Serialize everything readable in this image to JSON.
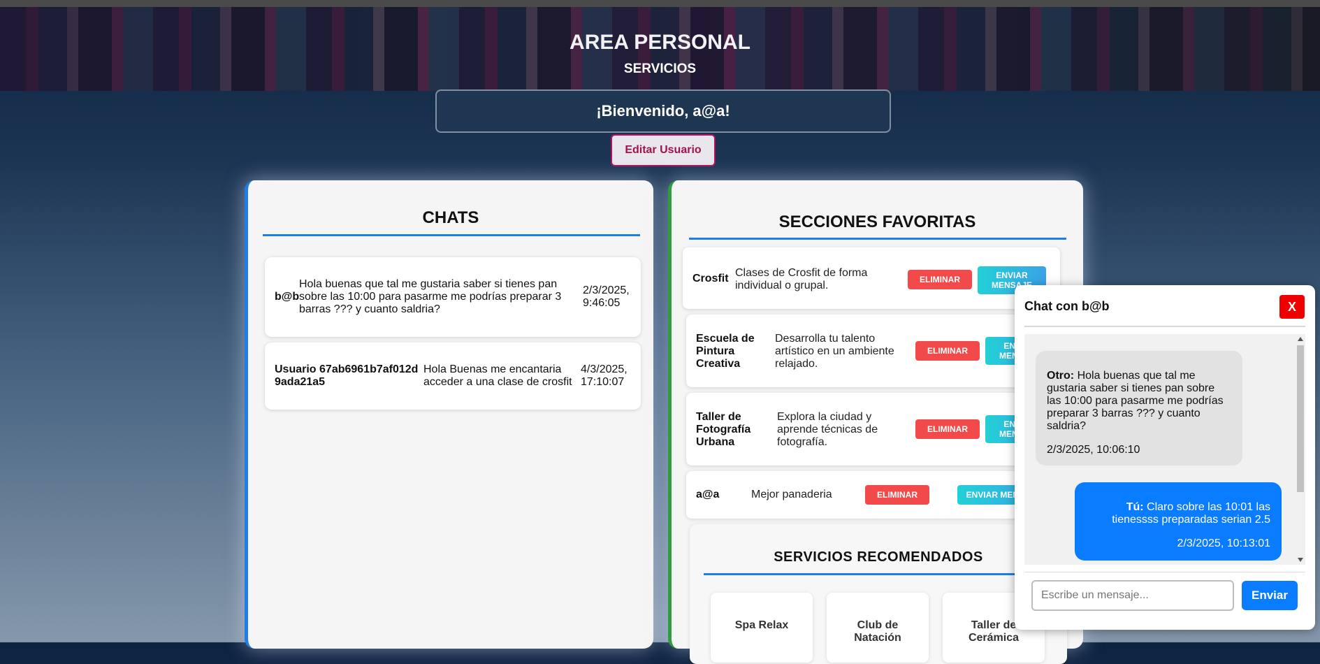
{
  "header": {
    "title": "AREA PERSONAL",
    "subtitle": "SERVICIOS"
  },
  "welcome": {
    "text": "¡Bienvenido, a@a!",
    "edit_button": "Editar Usuario"
  },
  "chats": {
    "title": "CHATS",
    "items": [
      {
        "user": "b@b",
        "message": "Hola buenas que tal me gustaria saber si tienes pan sobre las 10:00 para pasarme me podrías preparar 3 barras ??? y cuanto saldria?",
        "date": "2/3/2025,",
        "time": "9:46:05"
      },
      {
        "user": "Usuario 67ab6961b7af012d9ada21a5",
        "message": "Hola Buenas me encantaria acceder a una clase de crosfit",
        "date": "4/3/2025,",
        "time": "17:10:07"
      }
    ]
  },
  "favorites": {
    "title": "SECCIONES FAVORITAS",
    "delete_label": "ELIMINAR",
    "message_label": "ENVIAR MENSAJE",
    "items": [
      {
        "name": "Crosfit",
        "description": "Clases de Crosfit de forma individual o grupal."
      },
      {
        "name": "Escuela de Pintura Creativa",
        "description": "Desarrolla tu talento artístico en un ambiente relajado."
      },
      {
        "name": "Taller de Fotografía Urbana",
        "description": "Explora la ciudad y aprende técnicas de fotografía."
      },
      {
        "name": "a@a",
        "description": "Mejor panaderia"
      }
    ]
  },
  "recommended": {
    "title": "SERVICIOS RECOMENDADOS",
    "items": [
      {
        "name": "Spa Relax"
      },
      {
        "name": "Club de Natación"
      },
      {
        "name": "Taller de Cerámica"
      }
    ]
  },
  "chat_window": {
    "title": "Chat con b@b",
    "close_label": "X",
    "messages": [
      {
        "sender": "Otro:",
        "text": "Hola buenas que tal me gustaria saber si tienes pan sobre las 10:00 para pasarme me podrías preparar 3 barras ??? y cuanto saldria?",
        "time": "2/3/2025, 10:06:10"
      },
      {
        "sender": "Tú:",
        "text": "Claro sobre las 10:01 las tienessss preparadas serian 2.5",
        "time": "2/3/2025, 10:13:01"
      }
    ],
    "input_placeholder": "Escribe un mensaje...",
    "send_label": "Enviar"
  }
}
